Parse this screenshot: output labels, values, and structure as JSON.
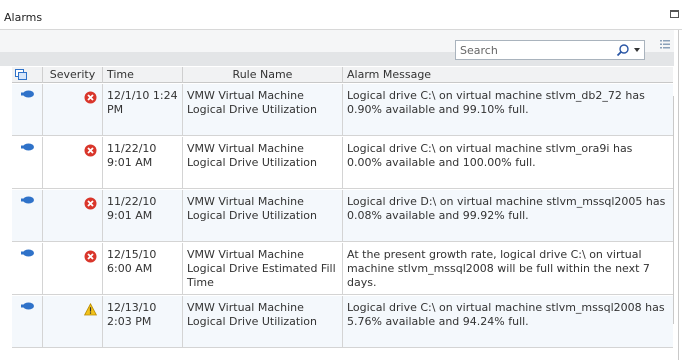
{
  "window": {
    "title": "Alarms"
  },
  "search": {
    "placeholder": "Search"
  },
  "columns": {
    "type": "",
    "severity": "Severity",
    "time": "Time",
    "rule_name": "Rule Name",
    "alarm_message": "Alarm Message"
  },
  "rows": [
    {
      "severity": "critical",
      "time": "12/1/10 1:24 PM",
      "rule_name": "VMW Virtual Machine Logical Drive Utilization",
      "message": "Logical drive C:\\ on virtual machine stlvm_db2_72 has 0.90% available and 99.10% full."
    },
    {
      "severity": "critical",
      "time": "11/22/10 9:01 AM",
      "rule_name": "VMW Virtual Machine Logical Drive Utilization",
      "message": "Logical drive C:\\ on virtual machine stlvm_ora9i has 0.00% available and 100.00% full."
    },
    {
      "severity": "critical",
      "time": "11/22/10 9:01 AM",
      "rule_name": "VMW Virtual Machine Logical Drive Utilization",
      "message": "Logical drive D:\\ on virtual machine stlvm_mssql2005 has 0.08% available and 99.92% full."
    },
    {
      "severity": "critical",
      "time": "12/15/10 6:00 AM",
      "rule_name": "VMW Virtual Machine Logical Drive Estimated Fill Time",
      "message": "At the present growth rate, logical drive C:\\ on virtual machine stlvm_mssql2008 will be full within the next 7 days."
    },
    {
      "severity": "warning",
      "time": "12/13/10 2:03 PM",
      "rule_name": "VMW Virtual Machine Logical Drive Utilization",
      "message": "Logical drive C:\\ on virtual machine stlvm_mssql2008 has 5.76% available and 94.24% full."
    }
  ],
  "colors": {
    "critical": "#d9362b",
    "warning": "#f2c21a",
    "type_icon": "#2f72c9"
  },
  "icons": {
    "type": "virtual-machine-icon",
    "critical": "critical-icon",
    "warning": "warning-icon",
    "search": "search-icon",
    "maximize": "maximize-icon",
    "options": "grid-options-icon"
  }
}
